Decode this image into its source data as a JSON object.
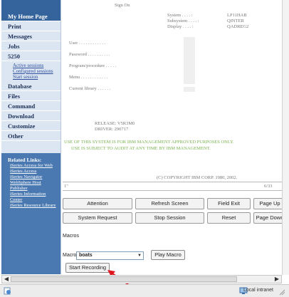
{
  "sidebar": {
    "items": [
      {
        "label": "My Home Page"
      },
      {
        "label": "Print"
      },
      {
        "label": "Messages"
      },
      {
        "label": "Jobs"
      },
      {
        "label": "5250"
      },
      {
        "label": "Database"
      },
      {
        "label": "Files"
      },
      {
        "label": "Command"
      },
      {
        "label": "Download"
      },
      {
        "label": "Customize"
      },
      {
        "label": "Other"
      }
    ],
    "sub_items": [
      {
        "label": "Active sessions"
      },
      {
        "label": "Configured sessions"
      },
      {
        "label": "Start session"
      }
    ],
    "related": {
      "title": "Related Links:",
      "links": [
        {
          "label": "iSeries Access for Web"
        },
        {
          "label": "iSeries Access"
        },
        {
          "label": "iSeries Navigator"
        },
        {
          "label": "WebSphere Host"
        },
        {
          "label": "Publisher"
        },
        {
          "label": "iSeries Information"
        },
        {
          "label": "Center"
        },
        {
          "label": "iSeries Resource Library"
        }
      ]
    }
  },
  "screen": {
    "sign_on": "Sign On",
    "system_label": "System . . . . :",
    "system_value": "LP11HAB",
    "subsystem_label": "Subsystem . . . . :",
    "subsystem_value": "QINTER",
    "display_label": "Display . . . . :",
    "display_value": "QADREG2",
    "user_label": "User . . . . . . . . . . . .",
    "password_label": "Password . . . . . . . . . .",
    "program_label": "Program/procedure . . . . .",
    "menu_label": "Menu . . . . . . . . . . . .",
    "library_label": "Current library . . . . . .",
    "release": "RELEASE: V5R3M0",
    "driver": "DRIVER: 290717",
    "warning_line1": "USE OF THIS SYSTEM IS FOR IBM MANAGEMENT APPROVED PURPOSES ONLY.",
    "warning_line2": "USE IS SUBJECT TO AUDIT AT ANY TIME BY IBM MANAGEMENT.",
    "copyright": "(C) COPYRIGHT IBM CORP. 1980, 2002.",
    "status_left": "1\"",
    "cursor_pos": "6/33"
  },
  "keys": [
    {
      "label": "Attention"
    },
    {
      "label": "Refresh Screen"
    },
    {
      "label": "Field Exit"
    },
    {
      "label": "Page Up"
    },
    {
      "label": "System Request"
    },
    {
      "label": "Stop Session"
    },
    {
      "label": "Reset"
    },
    {
      "label": "Page Down"
    }
  ],
  "macros": {
    "heading": "Macros",
    "select_label": "Macro:",
    "selected_macro": "boats",
    "play_label": "Play Macro",
    "record_label": "Start Recording"
  },
  "statusbar": {
    "zone": "Local intranet"
  },
  "colors": {
    "sidebar_dark": "#35649c",
    "sidebar_light": "#dce6f2",
    "warning_green": "#7ab150",
    "arrow_red": "#e0161e"
  }
}
